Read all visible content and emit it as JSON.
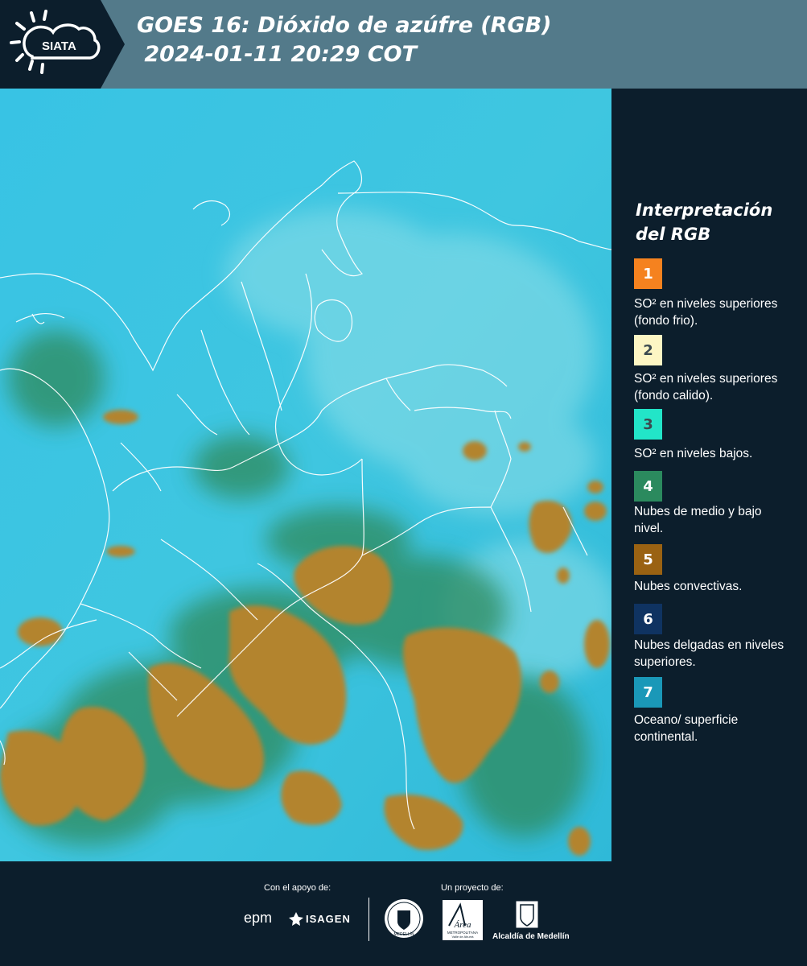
{
  "header": {
    "logo_text": "SIATA",
    "title_line1": "GOES 16: Dióxido de azúfre (RGB)",
    "title_line2": " 2024-01-11 20:29 COT"
  },
  "legend": {
    "title": "Interpretación del RGB",
    "items": [
      {
        "number": "1",
        "color": "#f5821f",
        "description": "SO² en niveles superiores (fondo frio)."
      },
      {
        "number": "2",
        "color": "#fdf6c4",
        "description": "SO² en niveles superiores (fondo calido)."
      },
      {
        "number": "3",
        "color": "#22e5c8",
        "description": "SO² en niveles bajos."
      },
      {
        "number": "4",
        "color": "#2b8a5e",
        "description": "Nubes de medio y bajo nivel."
      },
      {
        "number": "5",
        "color": "#9a6212",
        "description": "Nubes convectivas."
      },
      {
        "number": "6",
        "color": "#0f3361",
        "description": "Nubes delgadas en niveles superiores."
      },
      {
        "number": "7",
        "color": "#1a98b8",
        "description": "Oceano/ superficie continental."
      }
    ]
  },
  "footer": {
    "support_label": "Con el apoyo de:",
    "project_label": "Un proyecto de:",
    "epm_text": "epm",
    "isagen_text": "ISAGEN",
    "area_text": "Área",
    "area_sub1": "METROPOLITANA",
    "area_sub2": "Valle de Aburrá",
    "alcaldia_text": "Alcaldía de Medellín",
    "seal_text": "MEDELLÍN"
  },
  "map": {
    "ocean_color": "#36c5e3",
    "convective_color": "#b3842f",
    "low_cloud_color": "#2f8a5c"
  }
}
